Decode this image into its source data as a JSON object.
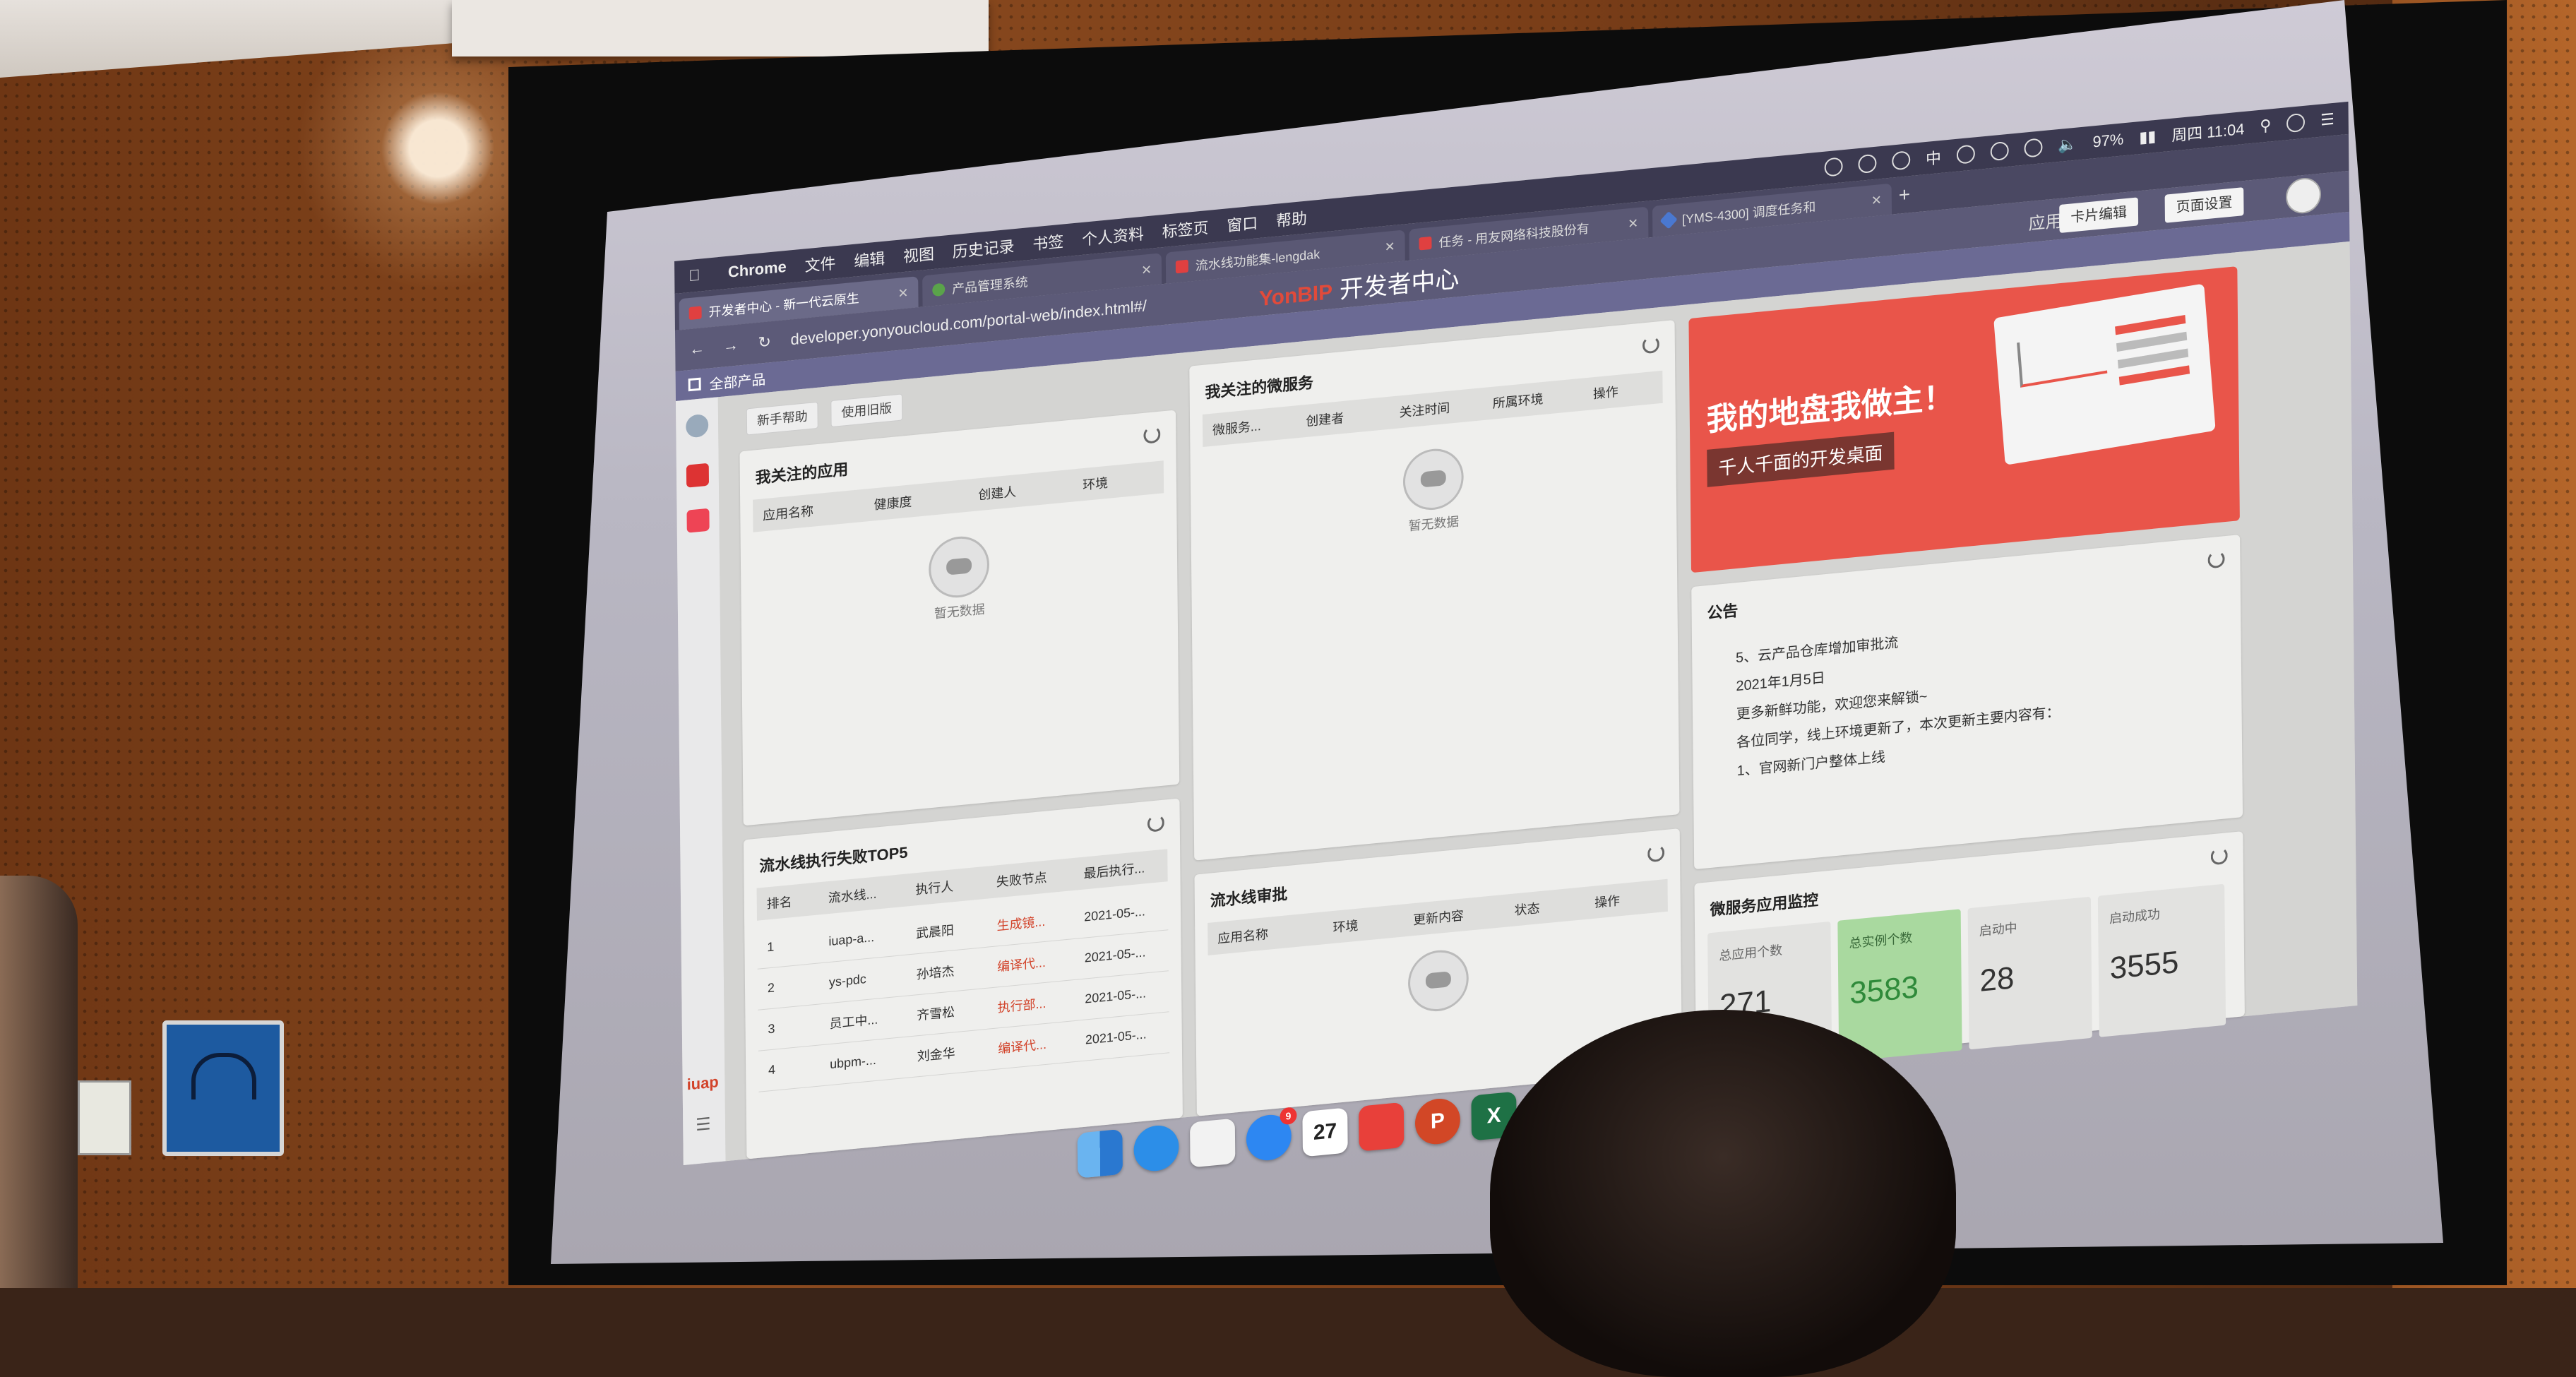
{
  "menubar": {
    "app": "Chrome",
    "items": [
      "文件",
      "编辑",
      "视图",
      "历史记录",
      "书签",
      "个人资料",
      "标签页",
      "窗口",
      "帮助"
    ],
    "clock": "周四 11:04",
    "battery": "97%",
    "input_method": "中"
  },
  "tabs": [
    {
      "label": "开发者中心 - 新一代云原生",
      "active": true
    },
    {
      "label": "产品管理系统",
      "active": false
    },
    {
      "label": "流水线功能集-lengdak",
      "active": false
    },
    {
      "label": "任务 - 用友网络科技股份有",
      "active": false
    },
    {
      "label": "[YMS-4300] 调度任务和",
      "active": false
    }
  ],
  "address": {
    "url": "developer.yonyoucloud.com/portal-web/index.html#/",
    "brand_logo": "YonBIP",
    "brand_title": "开发者中心",
    "app_market": "应用市场",
    "card_edit": "卡片编辑",
    "page_settings": "页面设置"
  },
  "secbar": {
    "all_products": "全部产品"
  },
  "sidebar": {
    "logo": "iuap"
  },
  "toolbar": {
    "beginner_help": "新手帮助",
    "old_version": "使用旧版"
  },
  "followed_apps": {
    "title": "我关注的应用",
    "columns": [
      "应用名称",
      "健康度",
      "创建人",
      "环境"
    ],
    "empty": "暂无数据"
  },
  "followed_services": {
    "title": "我关注的微服务",
    "columns": [
      "微服务...",
      "创建者",
      "关注时间",
      "所属环境",
      "操作"
    ],
    "empty": "暂无数据"
  },
  "banner": {
    "headline": "我的地盘我做主！",
    "subline": "千人千面的开发桌面"
  },
  "announcement": {
    "title": "公告",
    "lines": [
      "5、云产品仓库增加审批流",
      "2021年1月5日",
      "更多新鲜功能，欢迎您来解锁~",
      "各位同学，线上环境更新了，本次更新主要内容有：",
      "1、官网新门户整体上线"
    ]
  },
  "pipeline_top5": {
    "title": "流水线执行失败TOP5",
    "columns": [
      "排名",
      "流水线...",
      "执行人",
      "失败节点",
      "最后执行..."
    ],
    "rows": [
      {
        "rank": "1",
        "name": "iuap-a...",
        "user": "武晨阳",
        "node": "生成镜...",
        "time": "2021-05-..."
      },
      {
        "rank": "2",
        "name": "ys-pdc",
        "user": "孙培杰",
        "node": "编译代...",
        "time": "2021-05-..."
      },
      {
        "rank": "3",
        "name": "员工中...",
        "user": "齐雪松",
        "node": "执行部...",
        "time": "2021-05-..."
      },
      {
        "rank": "4",
        "name": "ubpm-...",
        "user": "刘金华",
        "node": "编译代...",
        "time": "2021-05-..."
      }
    ]
  },
  "pipeline_approval": {
    "title": "流水线审批",
    "columns": [
      "应用名称",
      "环境",
      "更新内容",
      "状态",
      "操作"
    ]
  },
  "monitor": {
    "title": "微服务应用监控",
    "stats": [
      {
        "label": "总应用个数",
        "value": "271"
      },
      {
        "label": "总实例个数",
        "value": "3583"
      },
      {
        "label": "启动中",
        "value": "28"
      },
      {
        "label": "启动成功",
        "value": "3555"
      }
    ]
  },
  "dock": {
    "calendar_day": "27",
    "appstore_badge": "9",
    "apps": [
      "finder-icon",
      "safari-icon",
      "notes-icon",
      "appstore-icon",
      "calendar-icon",
      "music-icon",
      "powerpoint-icon",
      "excel-icon",
      "word-icon"
    ]
  }
}
